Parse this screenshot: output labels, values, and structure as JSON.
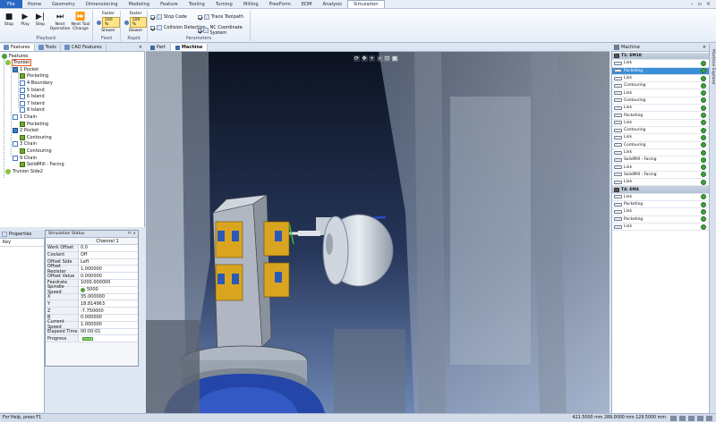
{
  "menu": {
    "tabs": [
      "File",
      "Home",
      "Geometry",
      "Dimensioning",
      "Modeling",
      "Feature",
      "Tooling",
      "Turning",
      "Milling",
      "FreeForm",
      "EDM",
      "Analysis",
      "Simulation"
    ],
    "active_tab": "Simulation"
  },
  "ribbon": {
    "playback": {
      "label": "Playback",
      "stop": "Stop",
      "play": "Play",
      "step": "Step",
      "next_operation": "Next Operation",
      "next_tool_change": "Next Tool Change"
    },
    "feed": {
      "label": "Feed",
      "faster": "Faster",
      "value": "100 %",
      "slower": "Slower"
    },
    "rapid": {
      "label": "Rapid",
      "faster": "Faster",
      "value": "100 %",
      "slower": "Slower"
    },
    "parameters": {
      "label": "Parameters",
      "stop_code": "Stop Code",
      "collision_detection": "Collision Detection",
      "trace_toolpath": "Trace Toolpath",
      "nc_coordinate_system": "NC Coordinate System"
    }
  },
  "left_tabs": [
    "Features",
    "Tools",
    "CAD Features"
  ],
  "tree": {
    "root": "Features",
    "trunion": "Trunion",
    "pocket1": "1 Pocket",
    "pocketing": "Pocketing",
    "boundary4": "4 Boundary",
    "island5": "5 Island",
    "island6": "6 Island",
    "island7": "7 Island",
    "island8": "8 Island",
    "chain1": "1 Chain",
    "pocketing2": "Pocketing",
    "pocket2": "2 Pocket",
    "contouring1": "Contouring",
    "chain3": "3 Chain",
    "contouring2": "Contouring",
    "chain9": "9 Chain",
    "solidmill": "SolidMill - Facing",
    "trunion_side2": "Trunion Side2"
  },
  "properties": {
    "title": "Properties",
    "key_header": "Key"
  },
  "sim_status": {
    "title": "Simulation Status",
    "channel": "Channel 1",
    "rows": [
      {
        "key": "Work Offset",
        "value": "0.0"
      },
      {
        "key": "Coolant",
        "value": "Off"
      },
      {
        "key": "Offset Side",
        "value": "Left"
      },
      {
        "key": "Offset Register",
        "value": "1.000000"
      },
      {
        "key": "Offset Value",
        "value": "0.000000"
      },
      {
        "key": "Feedrate",
        "value": "1000.000000"
      },
      {
        "key": "Spindle Speed",
        "value": "5000"
      },
      {
        "key": "X",
        "value": "35.000000"
      },
      {
        "key": "Y",
        "value": "18.814963"
      },
      {
        "key": "Z",
        "value": "-7.750000"
      },
      {
        "key": "B",
        "value": "0.000000"
      },
      {
        "key": "Current Speed",
        "value": "1.000000"
      },
      {
        "key": "Elapsed Time",
        "value": "00:00:01"
      },
      {
        "key": "Progress",
        "value": ""
      }
    ],
    "progress_fraction": 0.15
  },
  "viewport_tabs": [
    "Part",
    "Machine"
  ],
  "viewport_active": "Machine",
  "machine": {
    "tab": "Machine",
    "rows": [
      {
        "type": "head",
        "label": "T1: EM10"
      },
      {
        "type": "item",
        "label": "Link"
      },
      {
        "type": "item",
        "label": "Pocketing",
        "selected": true
      },
      {
        "type": "item",
        "label": "Link"
      },
      {
        "type": "item",
        "label": "Contouring"
      },
      {
        "type": "item",
        "label": "Link"
      },
      {
        "type": "item",
        "label": "Contouring"
      },
      {
        "type": "item",
        "label": "Link"
      },
      {
        "type": "item",
        "label": "Pocketing"
      },
      {
        "type": "item",
        "label": "Link"
      },
      {
        "type": "item",
        "label": "Contouring"
      },
      {
        "type": "item",
        "label": "Link"
      },
      {
        "type": "item",
        "label": "Contouring"
      },
      {
        "type": "item",
        "label": "Link"
      },
      {
        "type": "item",
        "label": "SolidMill - Facing"
      },
      {
        "type": "item",
        "label": "Link"
      },
      {
        "type": "item",
        "label": "SolidMill - Facing"
      },
      {
        "type": "item",
        "label": "Link"
      },
      {
        "type": "head",
        "label": "T4: EM4"
      },
      {
        "type": "item",
        "label": "Link"
      },
      {
        "type": "item",
        "label": "Pocketing"
      },
      {
        "type": "item",
        "label": "Link"
      },
      {
        "type": "item",
        "label": "Pocketing"
      },
      {
        "type": "item",
        "label": "Link"
      }
    ],
    "side_strip": "Machine Explorer"
  },
  "status": {
    "help": "For Help, press F1",
    "coords": "421.5000 mm  289.0000 mm  129.5000 mm"
  },
  "colors": {
    "accent": "#2b67c4",
    "selected": "#3b8fd8",
    "ok": "#3fa33a",
    "fixture_gold": "#d9a520",
    "viewport_top": "#0c1220"
  }
}
